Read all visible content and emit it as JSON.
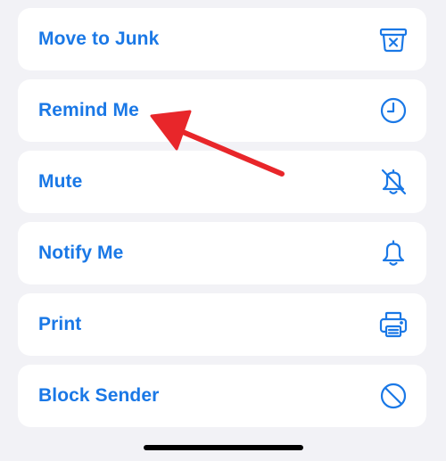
{
  "menu": {
    "items": [
      {
        "label": "Move to Junk",
        "icon": "junk-bin-icon"
      },
      {
        "label": "Remind Me",
        "icon": "clock-icon"
      },
      {
        "label": "Mute",
        "icon": "bell-slash-icon"
      },
      {
        "label": "Notify Me",
        "icon": "bell-icon"
      },
      {
        "label": "Print",
        "icon": "printer-icon"
      },
      {
        "label": "Block Sender",
        "icon": "block-icon"
      }
    ]
  },
  "colors": {
    "accent": "#1a78e6",
    "row_background": "#ffffff",
    "page_background": "#f2f2f6",
    "annotation_arrow": "#e8262a"
  }
}
